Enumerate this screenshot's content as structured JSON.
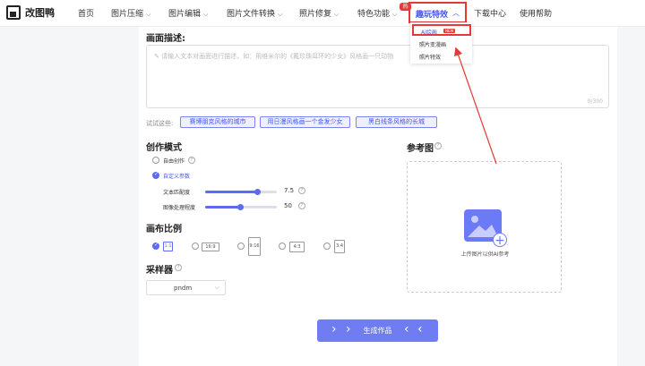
{
  "nav": {
    "brand": "改图鸭",
    "items": [
      {
        "label": "首页",
        "has_chevron": false
      },
      {
        "label": "图片压缩",
        "has_chevron": true
      },
      {
        "label": "图片编辑",
        "has_chevron": true
      },
      {
        "label": "图片文件转换",
        "has_chevron": true
      },
      {
        "label": "照片修复",
        "has_chevron": true
      },
      {
        "label": "特色功能",
        "has_chevron": true
      },
      {
        "label": "趣玩特效",
        "has_chevron": true,
        "active": true
      },
      {
        "label": "下载中心",
        "has_chevron": false
      },
      {
        "label": "使用帮助",
        "has_chevron": false
      }
    ],
    "hot_badge": "热",
    "chevron_icon": "chevron-down-icon",
    "active_color": "#4456e8",
    "highlight_color": "#e53935"
  },
  "dropdown": {
    "items": [
      "AI绘画",
      "照片变漫画",
      "照片特效"
    ],
    "new_badge": "NEW"
  },
  "prompt": {
    "label": "画面描述:",
    "placeholder": "请输入文本对画面进行描述，如：用维米尔的《戴珍珠耳环的少女》风格画一只动物",
    "counter": "0/300"
  },
  "try": {
    "label": "试试这些:",
    "chips": [
      "赛博朋克风格的城市",
      "用日漫风格画一个金发少女",
      "黑白线条风格的长城"
    ]
  },
  "mode": {
    "label": "创作模式",
    "options": [
      {
        "label": "自由创作",
        "selected": false
      },
      {
        "label": "自定义参数",
        "selected": true
      }
    ],
    "params": [
      {
        "label": "文本匹配度",
        "value": "7.5",
        "fill": 0.75
      },
      {
        "label": "图像处理程度",
        "value": "50",
        "fill": 0.5
      }
    ]
  },
  "ratio": {
    "label": "画布比例",
    "options": [
      {
        "label": "1:1",
        "selected": true
      },
      {
        "label": "16:9",
        "selected": false
      },
      {
        "label": "9:16",
        "selected": false
      },
      {
        "label": "4:3",
        "selected": false
      },
      {
        "label": "3:4",
        "selected": false
      }
    ]
  },
  "sampler": {
    "label": "采样器",
    "value": "pndm"
  },
  "reference": {
    "label": "参考图",
    "upload_text": "上传图片以供AI参考"
  },
  "generate": {
    "label": "生成作品"
  },
  "colors": {
    "accent": "#5c6bf0",
    "button": "#6f7cf2"
  }
}
